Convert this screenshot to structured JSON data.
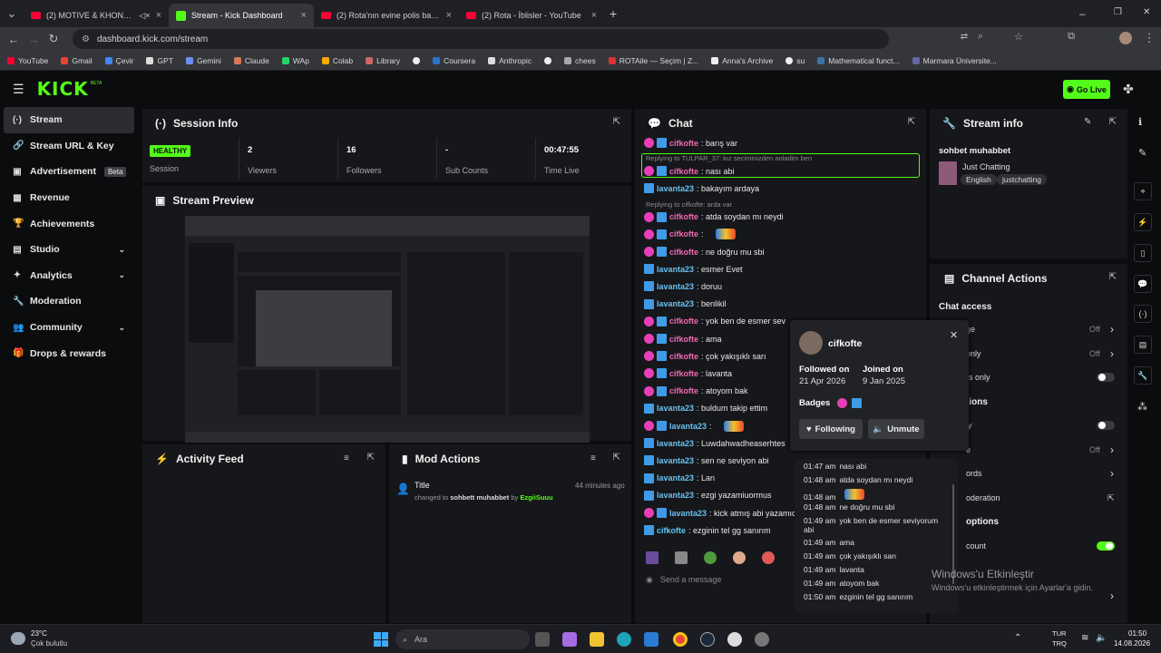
{
  "browser": {
    "tabs": [
      {
        "title": "(2) MOTIVE & KHONTKAR - …",
        "close": "×"
      },
      {
        "title": "Stream - Kick Dashboard",
        "close": "×"
      },
      {
        "title": "(2) Rota'nın evine polis baskını",
        "close": "×"
      },
      {
        "title": "(2) Rota - İblisler - YouTube",
        "close": "×"
      }
    ],
    "new_tab": "+",
    "url": "dashboard.kick.com/stream",
    "bookmarks": [
      "YouTube",
      "Gmail",
      "Çevir",
      "GPT",
      "Gemini",
      "Claude",
      "WAp",
      "Colab",
      "Library",
      "Coursera",
      "Anthropic",
      "chees",
      "ROTAile — Seçim | Z...",
      "Anna's Archive",
      "su",
      "Mathematical funct...",
      "Marmara Üniversite..."
    ],
    "window_controls": {
      "minimize": "–",
      "maximize": "❐",
      "close": "✕"
    }
  },
  "kick": {
    "logo": "KICK",
    "logo_beta": "BETA",
    "go_live": "Go Live",
    "sidebar": [
      {
        "label": "Stream",
        "icon": "(·)"
      },
      {
        "label": "Stream URL & Key",
        "icon": "🔗"
      },
      {
        "label": "Advertisement",
        "icon": "▣",
        "badge": "Beta"
      },
      {
        "label": "Revenue",
        "icon": "▦"
      },
      {
        "label": "Achievements",
        "icon": "🏆"
      },
      {
        "label": "Studio",
        "icon": "▤",
        "chevron": "⌄"
      },
      {
        "label": "Analytics",
        "icon": "✦",
        "chevron": "⌄"
      },
      {
        "label": "Moderation",
        "icon": "🔧"
      },
      {
        "label": "Community",
        "icon": "👥",
        "chevron": "⌄"
      },
      {
        "label": "Drops & rewards",
        "icon": "🎁"
      }
    ]
  },
  "session": {
    "title": "Session Info",
    "healthy": "HEALTHY",
    "session_label": "Session",
    "viewers": "2",
    "viewers_label": "Viewers",
    "followers": "16",
    "followers_label": "Followers",
    "subs": "-",
    "subs_label": "Sub Counts",
    "time": "00:47:55",
    "time_label": "Time Live"
  },
  "preview": {
    "title": "Stream Preview"
  },
  "activity": {
    "title": "Activity Feed"
  },
  "mod": {
    "title": "Mod Actions",
    "entry_title": "Title",
    "entry_time": "44 minutes ago",
    "entry_changed": "changed to",
    "entry_value": "sohbett muhabbet",
    "entry_by": "by",
    "entry_user": "EzgiiSuuu"
  },
  "chat": {
    "title": "Chat",
    "send_placeholder": "Send a message",
    "lines": [
      {
        "user": "cifkofte",
        "text": ": barış var",
        "b": "mk"
      },
      {
        "reply": "Replying to TULPAR_37: kız seciminizden anladim ben"
      },
      {
        "user": "cifkofte",
        "text": ": nası abi",
        "b": "mk"
      },
      {
        "user": "lavanta23",
        "text": ": bakayım ardaya",
        "b": "k"
      },
      {
        "reply": "Replying to cifkofte: arda var"
      },
      {
        "user": "cifkofte",
        "text": ": atda soydan mı neydi",
        "b": "mk"
      },
      {
        "user": "cifkofte",
        "text": ":",
        "b": "mk"
      },
      {
        "user": "cifkofte",
        "text": ": ne doğru mu sbi",
        "b": "mk"
      },
      {
        "user": "lavanta23",
        "text": ": esmer Evet",
        "b": "k"
      },
      {
        "user": "lavanta23",
        "text": ": doruu",
        "b": "k"
      },
      {
        "user": "lavanta23",
        "text": ": benlikil",
        "b": "k"
      },
      {
        "user": "cifkofte",
        "text": ": yok ben de esmer sev",
        "b": "mk"
      },
      {
        "user": "cifkofte",
        "text": ": ama",
        "b": "mk"
      },
      {
        "user": "cifkofte",
        "text": ": çok yakışıklı sarı",
        "b": "mk"
      },
      {
        "user": "cifkofte",
        "text": ": lavanta",
        "b": "mk"
      },
      {
        "user": "cifkofte",
        "text": ": atoyom bak",
        "b": "mk"
      },
      {
        "user": "lavanta23",
        "text": ": buldum takip ettim",
        "b": "k"
      },
      {
        "user": "lavanta23",
        "text": ":",
        "b": "mk"
      },
      {
        "user": "lavanta23",
        "text": ": Luwdahwadheaserhtes",
        "b": "k"
      },
      {
        "user": "lavanta23",
        "text": ": sen ne seviyon abi",
        "b": "k"
      },
      {
        "user": "lavanta23",
        "text": ": Lan",
        "b": "k"
      },
      {
        "user": "lavanta23",
        "text": ": ezgi yazamiuormus",
        "b": "k"
      },
      {
        "user": "lavanta23",
        "text": ": kick atmış abi yazamıc",
        "b": "mk"
      },
      {
        "user": "cifkofte",
        "text": ": ezginin tel gg sanırım",
        "b": "k"
      }
    ]
  },
  "popup": {
    "username": "cifkofte",
    "followed_on_label": "Followed on",
    "followed_on": "21 Apr 2026",
    "joined_on_label": "Joined on",
    "joined_on": "9 Jan 2025",
    "badges_label": "Badges",
    "following_btn": "Following",
    "unmute_btn": "Unmute",
    "history": [
      {
        "t": "01:47 am",
        "m": "nası abi"
      },
      {
        "t": "01:48 am",
        "m": "atda soydan mı neydi"
      },
      {
        "t": "01:48 am",
        "m": ""
      },
      {
        "t": "01:48 am",
        "m": "ne doğru mu sbi"
      },
      {
        "t": "01:49 am",
        "m": "yok ben de esmer seviyorum abi"
      },
      {
        "t": "01:49 am",
        "m": "ama"
      },
      {
        "t": "01:49 am",
        "m": "çok yakışıklı sarı"
      },
      {
        "t": "01:49 am",
        "m": "lavanta"
      },
      {
        "t": "01:49 am",
        "m": "atoyom bak"
      },
      {
        "t": "01:50 am",
        "m": "ezginin tel gg sanırım"
      }
    ]
  },
  "stream_info": {
    "title": "Stream info",
    "stream_title": "sohbet muhabbet",
    "category": "Just Chatting",
    "tags": [
      "English",
      "justchatting"
    ]
  },
  "channel": {
    "title": "Channel Actions",
    "chat_access": "Chat access",
    "rows": [
      {
        "label": "ge",
        "value": "Off",
        "ctl": "chev"
      },
      {
        "label": "only",
        "value": "Off",
        "ctl": "chev"
      },
      {
        "label": "rs only",
        "value": "",
        "ctl": "toggle"
      },
      {
        "label": "tions",
        "value": "",
        "ctl": "heading"
      },
      {
        "label": "ly",
        "value": "",
        "ctl": "toggle"
      },
      {
        "label": "e",
        "value": "Off",
        "ctl": "chev"
      },
      {
        "label": "ords",
        "value": "",
        "ctl": "chev"
      },
      {
        "label": "oderation",
        "value": "",
        "ctl": "ext"
      },
      {
        "label": "options",
        "value": "",
        "ctl": "heading"
      },
      {
        "label": "count",
        "value": "",
        "ctl": "toggle-on"
      }
    ]
  },
  "watermark": {
    "line1": "Windows'u Etkinleştir",
    "line2": "Windows'u etkinleştirmek için Ayarlar'a gidin."
  },
  "taskbar": {
    "weather_temp": "23°C",
    "weather_desc": "Çok bulutlu",
    "search": "Ara",
    "lang": "TUR",
    "lang2": "TRQ",
    "time": "01:50",
    "date": "14.08.2026"
  }
}
